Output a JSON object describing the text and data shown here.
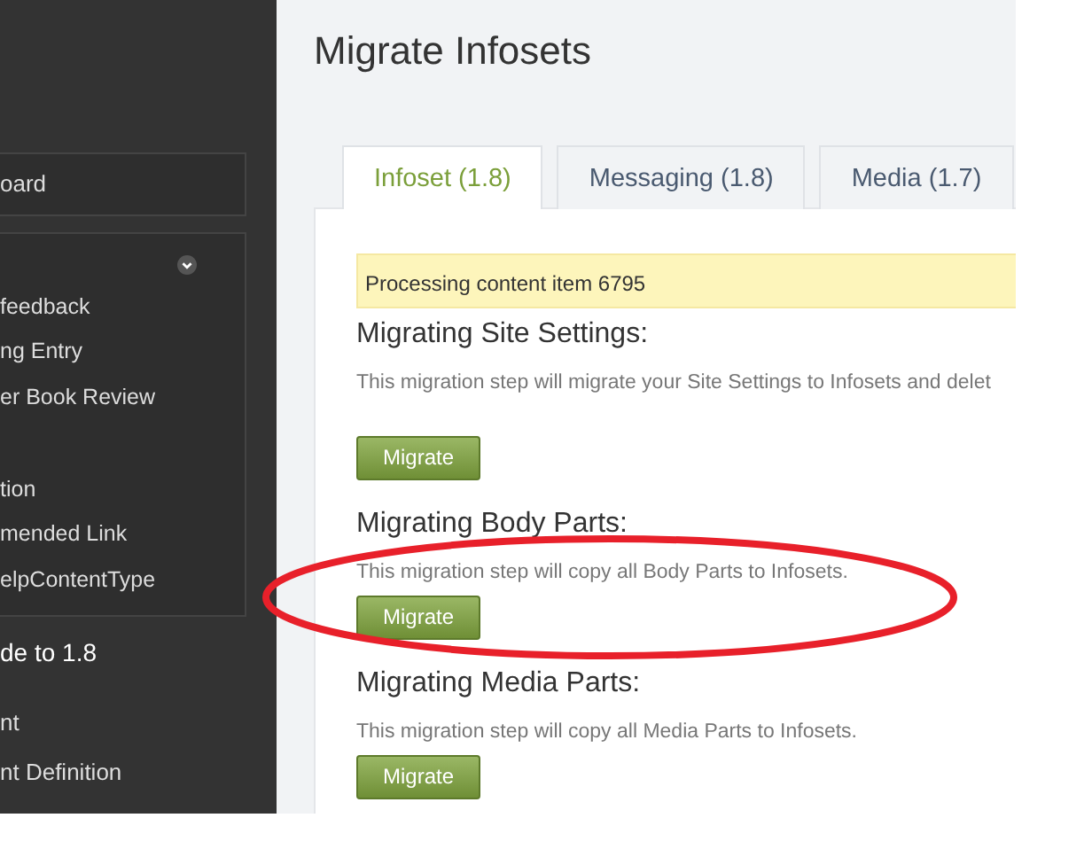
{
  "sidebar": {
    "items": [
      {
        "kind": "box",
        "label": "oard"
      },
      {
        "kind": "group",
        "expanded": true,
        "children": [
          {
            "label": "feedback"
          },
          {
            "label": "ng Entry"
          },
          {
            "label": "er Book Review"
          },
          {
            "label": "tion"
          },
          {
            "label": "mended Link"
          },
          {
            "label": "elpContentType"
          }
        ]
      },
      {
        "kind": "heading",
        "label": "de to 1.8"
      },
      {
        "kind": "link",
        "label": "nt"
      },
      {
        "kind": "link",
        "label": "nt Definition"
      }
    ]
  },
  "page": {
    "title": "Migrate Infosets"
  },
  "tabs": [
    {
      "label": "Infoset (1.8)",
      "selected": true
    },
    {
      "label": "Messaging (1.8)",
      "selected": false
    },
    {
      "label": "Media (1.7)",
      "selected": false
    }
  ],
  "alert": "Processing content item 6795",
  "steps": [
    {
      "title": "Migrating Site Settings:",
      "description": "This migration step will migrate your Site Settings to Infosets and delet",
      "button": "Migrate"
    },
    {
      "title": "Migrating Body Parts:",
      "description": "This migration step will copy all Body Parts to Infosets.",
      "button": "Migrate"
    },
    {
      "title": "Migrating Media Parts:",
      "description": "This migration step will copy all Media Parts to Infosets.",
      "button": "Migrate"
    }
  ],
  "annotation": {
    "kind": "ellipse"
  }
}
